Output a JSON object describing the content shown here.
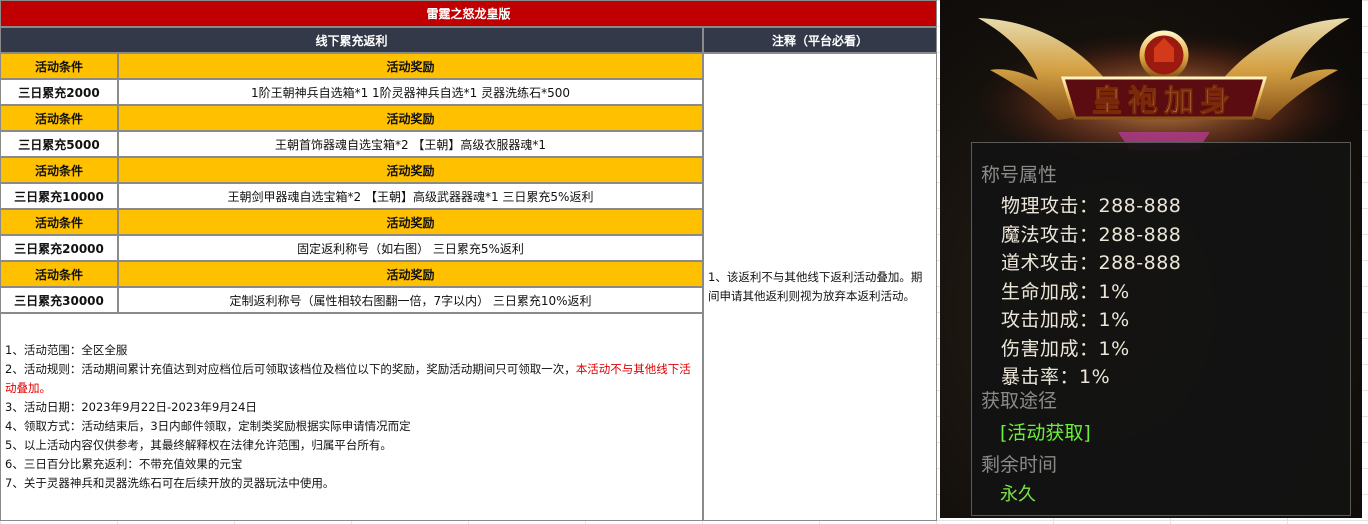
{
  "sheet": {
    "title": "雷霆之怒龙皇版",
    "section_header": "线下累充返利",
    "remark_header": "注释（平台必看）",
    "condition_label": "活动条件",
    "reward_label": "活动奖励",
    "tiers": [
      {
        "condition": "三日累充2000",
        "reward": "1阶王朝神兵自选箱*1 1阶灵器神兵自选*1 灵器洗练石*500"
      },
      {
        "condition": "三日累充5000",
        "reward": "王朝首饰器魂自选宝箱*2 【王朝】高级衣服器魂*1"
      },
      {
        "condition": "三日累充10000",
        "reward": "王朝剑甲器魂自选宝箱*2 【王朝】高级武器器魂*1 三日累充5%返利"
      },
      {
        "condition": "三日累充20000",
        "reward": "固定返利称号（如右图） 三日累充5%返利"
      },
      {
        "condition": "三日累充30000",
        "reward": "定制返利称号（属性相较右图翻一倍，7字以内） 三日累充10%返利"
      }
    ],
    "remark_text": "1、该返利不与其他线下返利活动叠加。期间申请其他返利则视为放弃本返利活动。",
    "notes": {
      "l1": "1、活动范围：全区全服",
      "l2_a": "2、活动规则：活动期间累计充值达到对应档位后可领取该档位及档位以下的奖励，奖励活动期间只可领取一次，",
      "l2_b": "本活动不与其他线下活动叠加。",
      "l3": "3、活动日期：2023年9月22日-2023年9月24日",
      "l4": "4、领取方式：活动结束后，3日内邮件领取，定制类奖励根据实际申请情况而定",
      "l5": "5、以上活动内容仅供参考，其最终解释权在法律允许范围，归属平台所有。",
      "l6": "6、三日百分比累充返利：不带充值效果的元宝",
      "l7": "7、关于灵器神兵和灵器洗练石可在后续开放的灵器玩法中使用。"
    }
  },
  "game_tooltip": {
    "emblem_text": "皇袍加身",
    "section_attrs": "称号属性",
    "attrs": [
      "物理攻击：288-888",
      "魔法攻击：288-888",
      "道术攻击：288-888",
      "生命加成：1%",
      "攻击加成：1%",
      "伤害加成：1%",
      "暴击率：1%"
    ],
    "section_source": "获取途径",
    "source_value": "[活动获取]",
    "section_time": "剩余时间",
    "time_value": "永久",
    "colors": {
      "attr_text": "#ece6d8",
      "green": "#6cf03a",
      "section_grey": "#8a8a86"
    }
  }
}
